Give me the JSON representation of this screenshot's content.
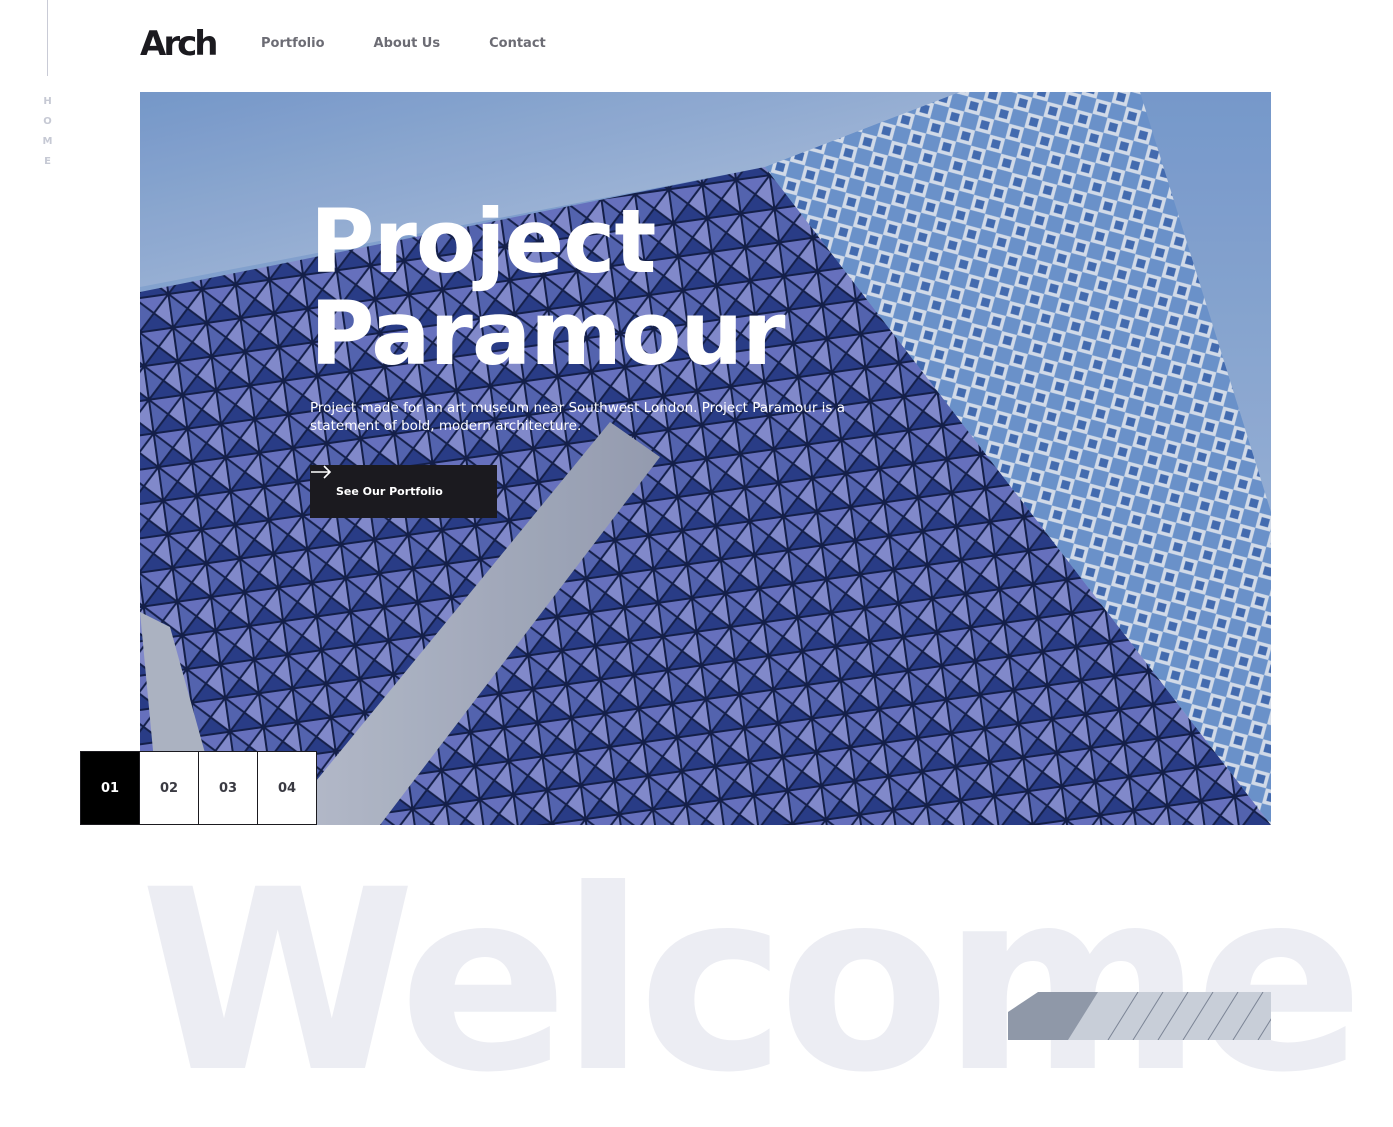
{
  "side": {
    "label_letters": [
      "H",
      "O",
      "M",
      "E"
    ]
  },
  "header": {
    "logo": "Arch",
    "nav": [
      "Portfolio",
      "About Us",
      "Contact"
    ]
  },
  "hero": {
    "title_line1": "Project",
    "title_line2": "Paramour",
    "description": "Project made for an art museum near Southwest London. Project Paramour is a statement of bold, modern architecture.",
    "cta_label": "See Our Portfolio"
  },
  "slider": {
    "items": [
      "01",
      "02",
      "03",
      "04"
    ],
    "active": "01"
  },
  "welcome": {
    "text": "Welcome"
  },
  "colors": {
    "dark": "#1b1a1f",
    "nav_text": "#6c6c74",
    "welcome_text": "#ecedf3",
    "facade_blue": "#3f57a6"
  }
}
